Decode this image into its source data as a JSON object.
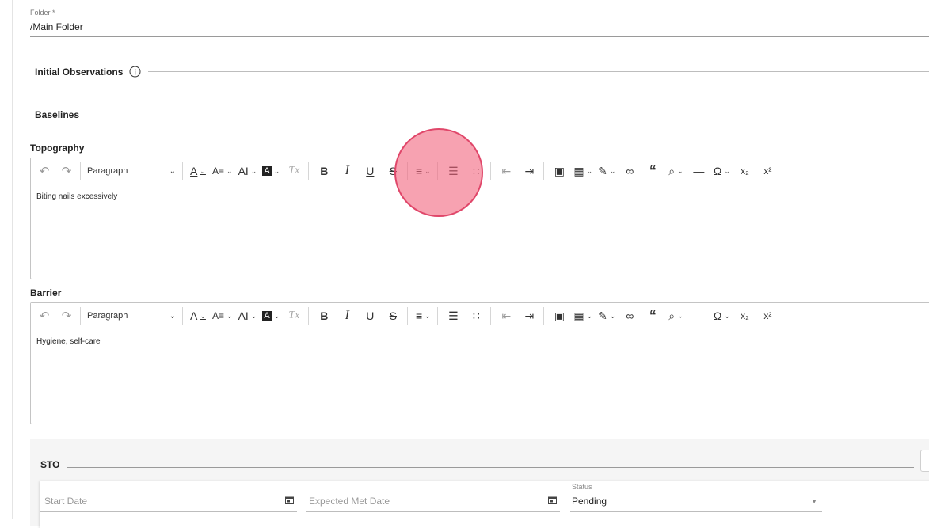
{
  "folder": {
    "label": "Folder *",
    "value": "/Main Folder"
  },
  "sections": {
    "initial_observations": "Initial Observations",
    "baselines": "Baselines"
  },
  "toolbar": {
    "paragraph": "Paragraph",
    "undo_icon": "↶",
    "redo_icon": "↷",
    "font_color_icon": "A",
    "font_size_icon": "A≡",
    "font_family_icon": "AI",
    "highlight_bg_icon": "A",
    "clear_format_icon": "Tx",
    "bold": "B",
    "italic": "I",
    "underline": "U",
    "strike": "S",
    "align_icon": "≡",
    "numbered_list_icon": "☰",
    "bullet_list_icon": "∷",
    "outdent_icon": "⇤",
    "indent_icon": "⇥",
    "image_icon": "▣",
    "table_icon": "▦",
    "highlighter_icon": "✎",
    "link_icon": "∞",
    "quote_icon": "“",
    "find_icon": "⌕",
    "hr_icon": "—",
    "special_char_icon": "Ω",
    "subscript": "x₂",
    "superscript": "x²"
  },
  "topography": {
    "title": "Topography",
    "content": "Biting nails excessively"
  },
  "barrier": {
    "title": "Barrier",
    "content": "Hygiene, self-care"
  },
  "sto": {
    "title": "STO",
    "start_date_placeholder": "Start Date",
    "expected_met_placeholder": "Expected Met Date",
    "status_label": "Status",
    "status_value": "Pending"
  },
  "colors": {
    "click_indicator": "#f2647d",
    "border": "#c4c4c4",
    "panel_bg": "#f5f5f5"
  }
}
